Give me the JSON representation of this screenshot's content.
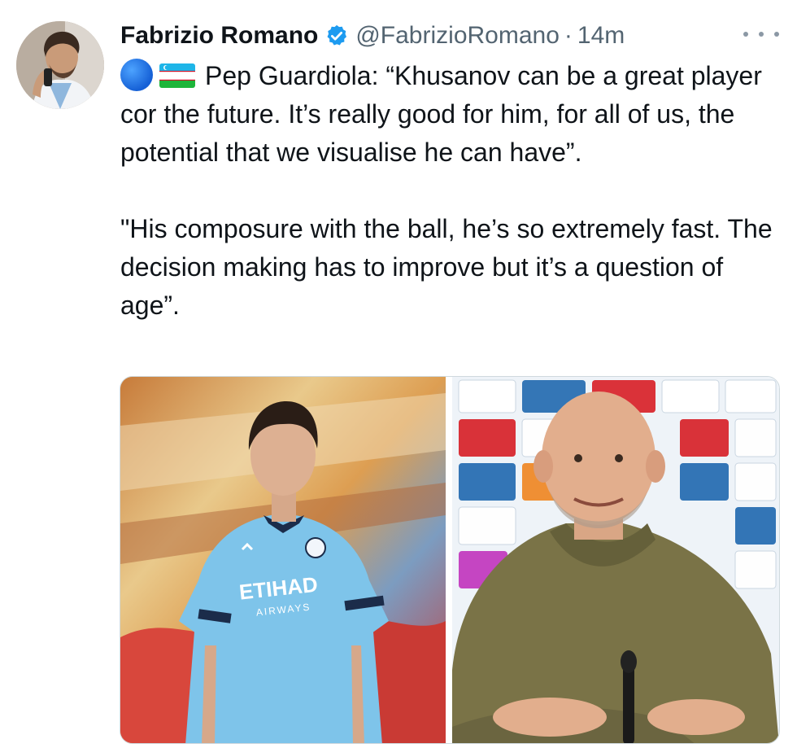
{
  "tweet": {
    "author": {
      "name": "Fabrizio Romano",
      "handle": "@FabrizioRomano",
      "verified": true
    },
    "separator": "·",
    "timestamp": "14m",
    "paragraphs": [
      "Pep Guardiola: “Khusanov can be a great player cor the future. It’s really good for him, for all of us, the potential that we visualise he can have”.",
      "\"His composure with the ball, he’s so extremely fast. The decision making has to improve but it’s a question of age”."
    ],
    "emoji": [
      "blue-circle",
      "uzbekistan-flag"
    ],
    "media": {
      "left_image_text": {
        "sponsor": "ETIHAD",
        "sponsor_sub": "AIRWAYS"
      }
    }
  },
  "colors": {
    "text": "#0f1419",
    "secondary": "#536471",
    "verified_blue": "#1d9bf0",
    "city_blue": "#7ec4ea"
  }
}
